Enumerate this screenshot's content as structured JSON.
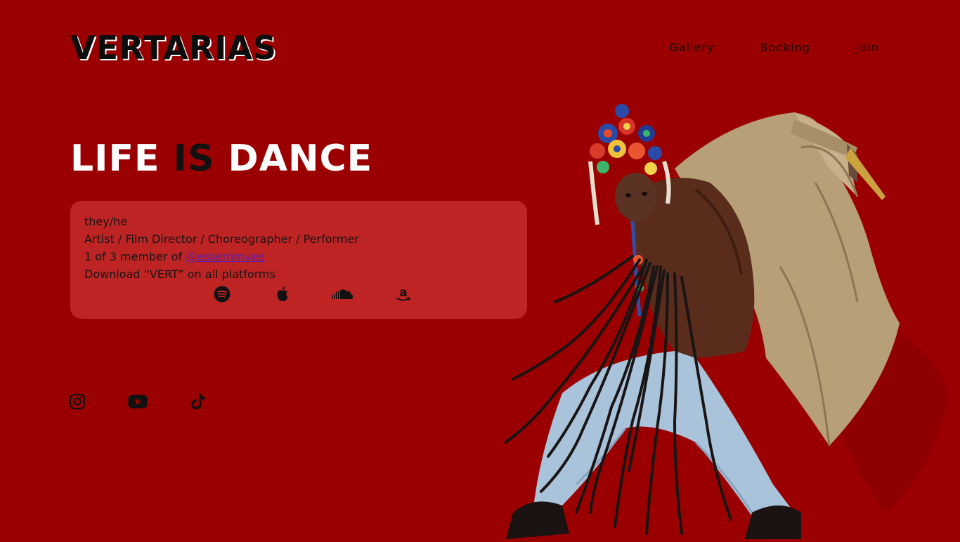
{
  "brand": {
    "logo": "VERTARIAS"
  },
  "nav": {
    "items": [
      "Gallery",
      "Booking",
      "Join"
    ]
  },
  "hero": {
    "headline_part1": "LIFE ",
    "headline_emphasis": "IS",
    "headline_part2": " DANCE"
  },
  "bio": {
    "pronouns": "they/he",
    "roles": "Artist / Film Director / Choreographer / Performer",
    "member_prefix": "1 of 3 member of ",
    "member_link": "@essemmvee",
    "download": "Download “VERT” on all platforms"
  },
  "platforms": [
    "spotify-icon",
    "apple-icon",
    "soundcloud-icon",
    "amazon-icon"
  ],
  "social": [
    "instagram-icon",
    "youtube-icon",
    "tiktok-icon"
  ],
  "colors": {
    "background": "#9b0000",
    "card": "#bf2424",
    "text": "#111111",
    "link": "#5a1fa8",
    "headline": "#ffffff"
  }
}
